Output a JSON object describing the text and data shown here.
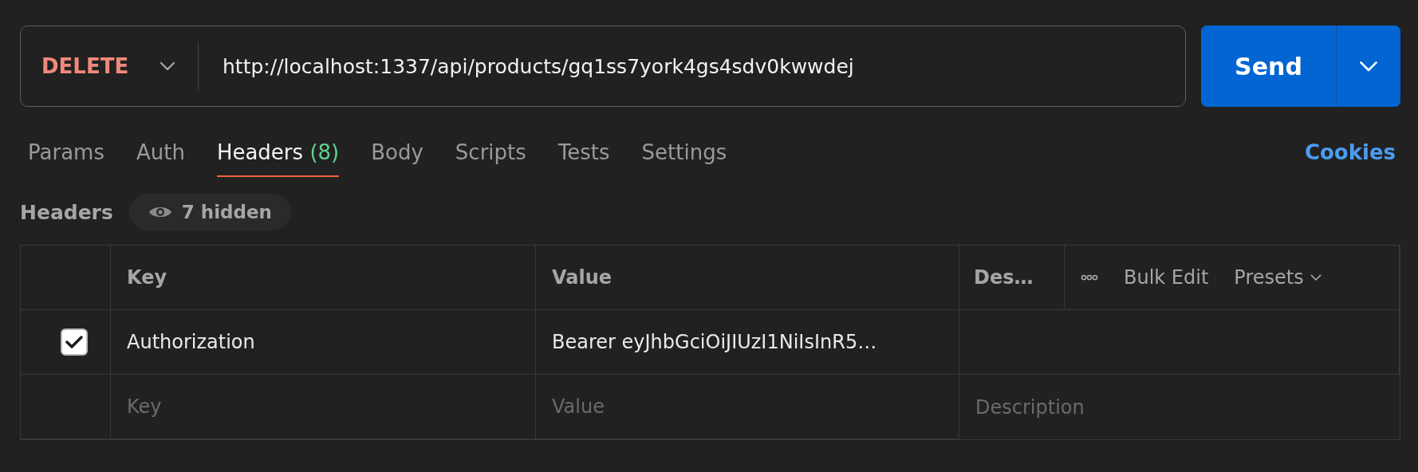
{
  "request": {
    "method": "DELETE",
    "url": "http://localhost:1337/api/products/gq1ss7york4gs4sdv0kwwdej",
    "send": "Send"
  },
  "tabs": [
    {
      "label": "Params",
      "selected": false
    },
    {
      "label": "Auth",
      "selected": false
    },
    {
      "label": "Headers",
      "count": "(8)",
      "selected": true
    },
    {
      "label": "Body",
      "selected": false
    },
    {
      "label": "Scripts",
      "selected": false
    },
    {
      "label": "Tests",
      "selected": false
    },
    {
      "label": "Settings",
      "selected": false
    }
  ],
  "cookies": "Cookies",
  "headers_bar": {
    "title": "Headers",
    "hidden": "7 hidden"
  },
  "table": {
    "columns": [
      "Key",
      "Value",
      "Des…"
    ],
    "bulk_edit": "Bulk Edit",
    "presets": "Presets",
    "rows": [
      {
        "checked": true,
        "key": "Authorization",
        "value": "Bearer eyJhbGciOiJIUzI1NiIsInR5…"
      }
    ],
    "new_row": {
      "key_placeholder": "Key",
      "value_placeholder": "Value",
      "description_placeholder": "Description"
    }
  }
}
